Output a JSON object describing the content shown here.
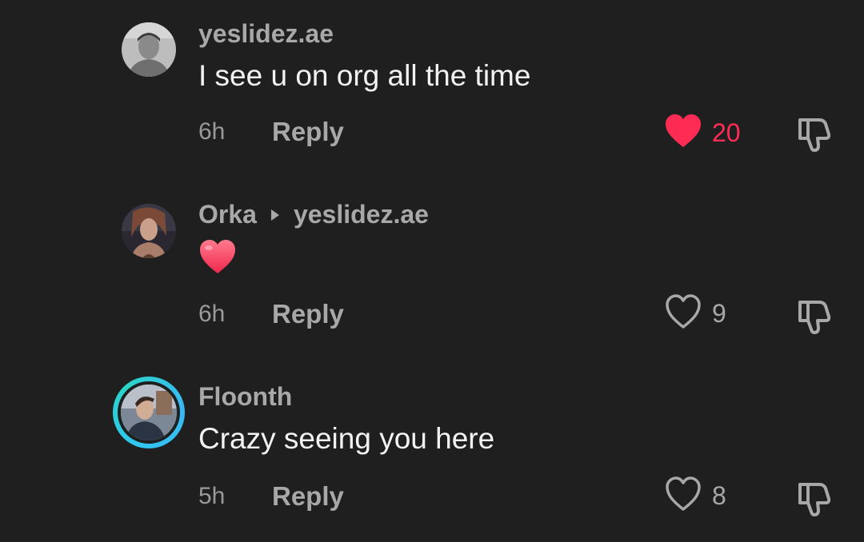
{
  "colors": {
    "background": "#1f1f1f",
    "username": "#a8a8a8",
    "text": "#f2f2f2",
    "liked": "#fe2c55",
    "story_ring": "#30c6f0"
  },
  "comments": [
    {
      "username": "yeslidez.ae",
      "text": "I see u on org all the time",
      "time": "6h",
      "reply_label": "Reply",
      "likes": "20",
      "liked": true,
      "dislike_icon": "thumbs-down-icon"
    },
    {
      "username": "Orka",
      "reply_to": "yeslidez.ae",
      "text": "❤️",
      "time": "6h",
      "reply_label": "Reply",
      "likes": "9",
      "liked": false,
      "dislike_icon": "thumbs-down-icon"
    },
    {
      "username": "Floonth",
      "text": "Crazy seeing you here",
      "time": "5h",
      "reply_label": "Reply",
      "likes": "8",
      "liked": false,
      "has_story_ring": true,
      "dislike_icon": "thumbs-down-icon"
    }
  ]
}
